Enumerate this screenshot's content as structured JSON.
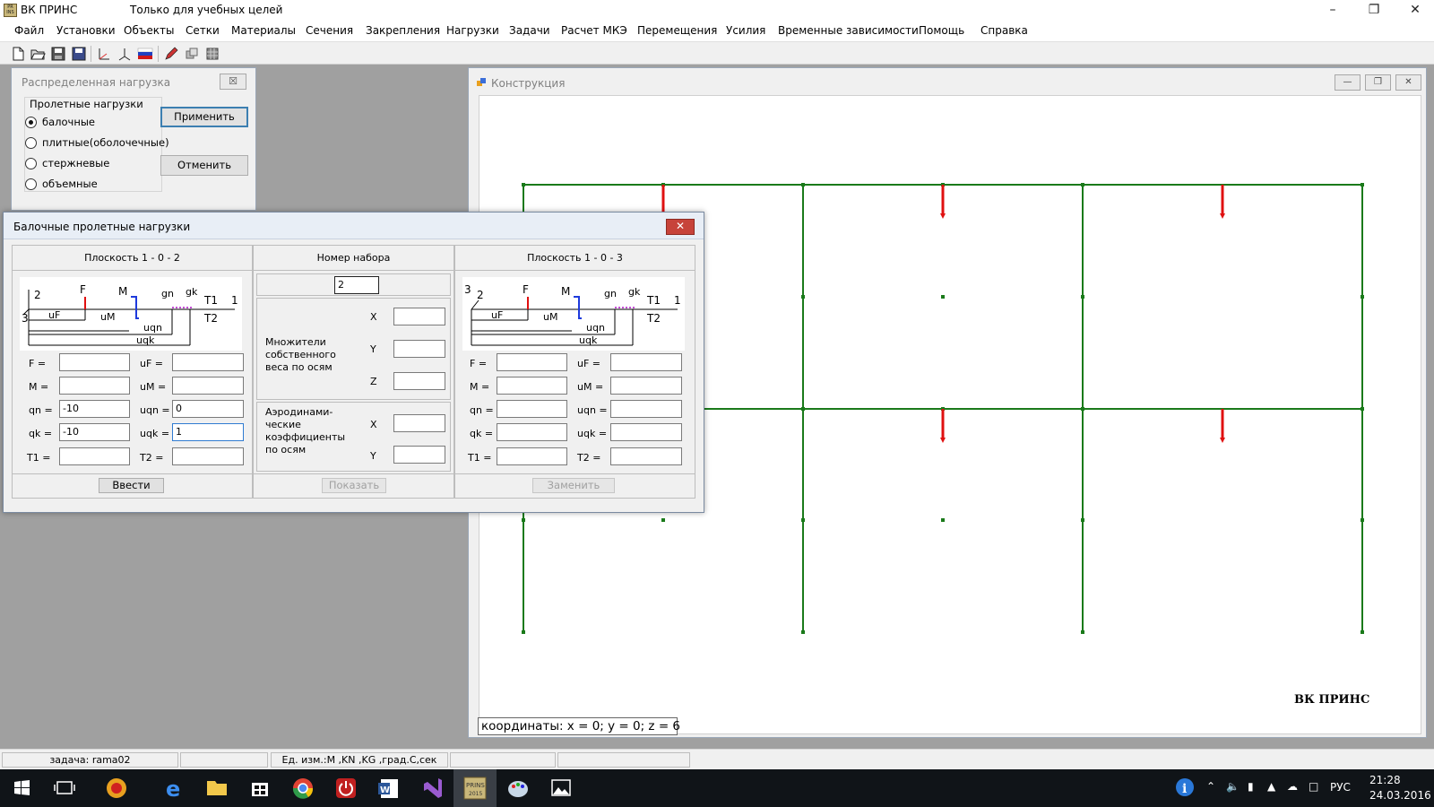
{
  "app": {
    "title": "ВК ПРИНС",
    "subtitle": "Только для учебных целей",
    "icon_text": "PRINS"
  },
  "menu": [
    "Файл",
    "Установки",
    "Объекты",
    "Сетки",
    "Материалы",
    "Сечения",
    "Закрепления",
    "Нагрузки",
    "Задачи",
    "Расчет МКЭ",
    "Перемещения",
    "Усилия",
    "Временные зависимости",
    "Помощь",
    "Справка"
  ],
  "toolbar": [
    "new-file-icon",
    "open-folder-icon",
    "save-icon",
    "save-all-icon",
    "axes-icon",
    "axes-3d-icon",
    "russian-flag-icon",
    "pencil-icon",
    "layers-icon",
    "grid-icon"
  ],
  "dist_window": {
    "title": "Распределенная нагрузка",
    "group_label": "Пролетные нагрузки",
    "options": [
      {
        "label": "балочные",
        "selected": true
      },
      {
        "label": "плитные(оболочечные)",
        "selected": false
      },
      {
        "label": "стержневые",
        "selected": false
      },
      {
        "label": "объемные",
        "selected": false
      }
    ],
    "apply_label": "Применить",
    "cancel_label": "Отменить"
  },
  "construction_window": {
    "title": "Конструкция",
    "brand": "ВК  ПРИНС",
    "coords": "координаты:   x = 0; y = 0; z = 6"
  },
  "beam_dialog": {
    "title": "Балочные пролетные нагрузки",
    "left_header": "Плоскость 1 - 0 - 2",
    "middle_header": "Номер набора",
    "right_header": "Плоскость 1 - 0 - 3",
    "set_number": "2",
    "left_schema_labels": {
      "axis_a": "2",
      "axis_b": "3",
      "axis_x": "1",
      "F": "F",
      "M": "M",
      "gn": "gn",
      "gk": "gk",
      "T1": "T1",
      "T2": "T2",
      "uF": "uF",
      "uM": "uM",
      "uqn": "uqn",
      "uqk": "uqk"
    },
    "right_schema_labels": {
      "axis_a": "2",
      "axis_b": "3",
      "axis_x": "1",
      "F": "F",
      "M": "M",
      "gn": "gn",
      "gk": "gk",
      "T1": "T1",
      "T2": "T2",
      "uF": "uF",
      "uM": "uM",
      "uqn": "uqn",
      "uqk": "uqk"
    },
    "left_fields": [
      {
        "label": "F =",
        "value": "",
        "label2": "uF =",
        "value2": ""
      },
      {
        "label": "M =",
        "value": "",
        "label2": "uM =",
        "value2": ""
      },
      {
        "label": "qn =",
        "value": "-10",
        "label2": "uqn =",
        "value2": "0"
      },
      {
        "label": "qk =",
        "value": "-10",
        "label2": "uqk =",
        "value2": "1"
      },
      {
        "label": "T1 =",
        "value": "",
        "label2": "T2 =",
        "value2": ""
      }
    ],
    "right_fields": [
      {
        "label": "F =",
        "value": "",
        "label2": "uF =",
        "value2": ""
      },
      {
        "label": "M =",
        "value": "",
        "label2": "uM =",
        "value2": ""
      },
      {
        "label": "qn =",
        "value": "",
        "label2": "uqn =",
        "value2": ""
      },
      {
        "label": "qk =",
        "value": "",
        "label2": "uqk =",
        "value2": ""
      },
      {
        "label": "T1 =",
        "value": "",
        "label2": "T2 =",
        "value2": ""
      }
    ],
    "self_weight_label": "Множители собственного веса по осям",
    "self_weight": [
      {
        "axis": "X",
        "value": ""
      },
      {
        "axis": "Y",
        "value": ""
      },
      {
        "axis": "Z",
        "value": ""
      }
    ],
    "aero_label": "Аэродинами- ческие коэффициенты по осям",
    "aero": [
      {
        "axis": "X",
        "value": ""
      },
      {
        "axis": "Y",
        "value": ""
      }
    ],
    "enter_label": "Ввести",
    "show_label": "Показать",
    "replace_label": "Заменить"
  },
  "status": {
    "task": "задача: rama02",
    "empty1": "",
    "units": "Ед. изм.:M ,KN  ,KG  ,град.С,сек",
    "empty2": "",
    "empty3": ""
  },
  "taskbar": {
    "time": "21:28",
    "date": "24.03.2016",
    "lang": "РУС"
  },
  "colors": {
    "frame": "#1a7a1a",
    "load": "#e01010",
    "moment": "#1e3adc",
    "temp": "#b012c8"
  }
}
